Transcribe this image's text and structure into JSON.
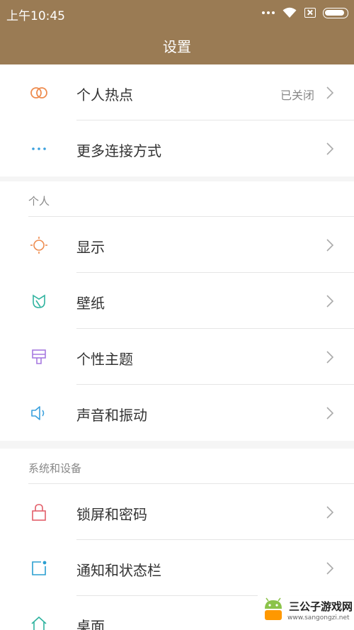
{
  "status_bar": {
    "time": "上午10:45"
  },
  "header": {
    "title": "设置"
  },
  "group1": {
    "items": [
      {
        "label": "个人热点",
        "value": "已关闭",
        "icon": "hotspot-icon"
      },
      {
        "label": "更多连接方式",
        "icon": "more-dots-icon"
      }
    ]
  },
  "personal": {
    "header": "个人",
    "items": [
      {
        "label": "显示",
        "icon": "display-sun-icon"
      },
      {
        "label": "壁纸",
        "icon": "wallpaper-icon"
      },
      {
        "label": "个性主题",
        "icon": "theme-brush-icon"
      },
      {
        "label": "声音和振动",
        "icon": "speaker-icon"
      }
    ]
  },
  "system": {
    "header": "系统和设备",
    "items": [
      {
        "label": "锁屏和密码",
        "icon": "lock-icon"
      },
      {
        "label": "通知和状态栏",
        "icon": "notification-icon"
      },
      {
        "label": "桌面",
        "icon": "home-icon"
      }
    ]
  },
  "watermark": {
    "title": "三公子游戏网",
    "url": "www.sangongzi.net"
  },
  "colors": {
    "header_bg": "#9a7b54",
    "hotspot": "#ee8c4f",
    "more": "#3aa0dd",
    "display": "#ee8c4f",
    "wallpaper": "#2fb39f",
    "theme": "#a779e0",
    "sound": "#3aa0dd",
    "lock": "#e35f6a",
    "notification": "#2a9fd0",
    "home": "#2fb39f"
  }
}
